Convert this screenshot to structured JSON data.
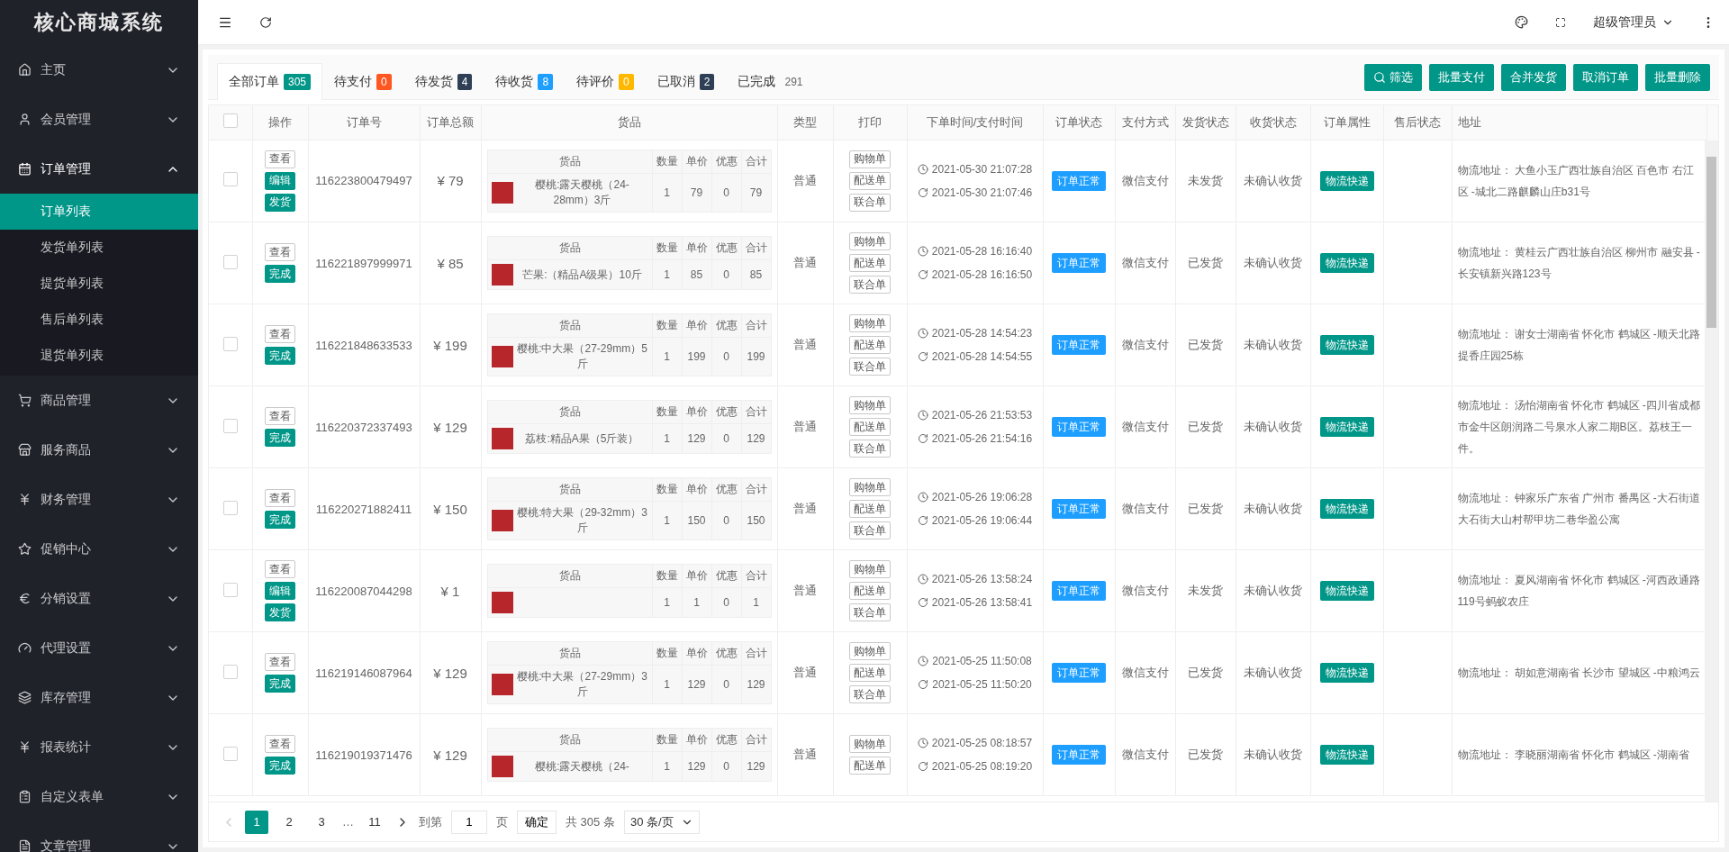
{
  "sidebar": {
    "title": "核心商城系统",
    "items": [
      {
        "label": "主页",
        "expanded": false
      },
      {
        "label": "会员管理",
        "expanded": false
      },
      {
        "label": "订单管理",
        "expanded": true,
        "children": [
          {
            "label": "订单列表",
            "selected": true
          },
          {
            "label": "发货单列表",
            "selected": false
          },
          {
            "label": "提货单列表",
            "selected": false
          },
          {
            "label": "售后单列表",
            "selected": false
          },
          {
            "label": "退货单列表",
            "selected": false
          }
        ]
      },
      {
        "label": "商品管理",
        "expanded": false
      },
      {
        "label": "服务商品",
        "expanded": false
      },
      {
        "label": "财务管理",
        "expanded": false
      },
      {
        "label": "促销中心",
        "expanded": false
      },
      {
        "label": "分销设置",
        "expanded": false
      },
      {
        "label": "代理设置",
        "expanded": false
      },
      {
        "label": "库存管理",
        "expanded": false
      },
      {
        "label": "报表统计",
        "expanded": false
      },
      {
        "label": "自定义表单",
        "expanded": false
      },
      {
        "label": "文章管理",
        "expanded": false
      }
    ]
  },
  "header": {
    "user": "超级管理员"
  },
  "tabs": [
    {
      "label": "全部订单",
      "count": "305",
      "color": "#009688",
      "selected": true
    },
    {
      "label": "待支付",
      "count": "0",
      "color": "#ff5722",
      "selected": false
    },
    {
      "label": "待发货",
      "count": "4",
      "color": "#2f4056",
      "selected": false
    },
    {
      "label": "待收货",
      "count": "8",
      "color": "#1e9fff",
      "selected": false
    },
    {
      "label": "待评价",
      "count": "0",
      "color": "#ffb800",
      "selected": false
    },
    {
      "label": "已取消",
      "count": "2",
      "color": "#2f4056",
      "selected": false
    },
    {
      "label": "已完成",
      "count": "291",
      "selected": false
    }
  ],
  "actions": [
    {
      "label": "筛选",
      "kind": "search"
    },
    {
      "label": "批量支付",
      "kind": "plain"
    },
    {
      "label": "合并发货",
      "kind": "plain"
    },
    {
      "label": "取消订单",
      "kind": "plain"
    },
    {
      "label": "批量删除",
      "kind": "plain"
    }
  ],
  "table": {
    "select_all": {
      "checked": false
    },
    "columns": [
      "操作",
      "订单号",
      "订单总额",
      "货品",
      "类型",
      "打印",
      "下单时间/支付时间",
      "订单状态",
      "支付方式",
      "发货状态",
      "收货状态",
      "订单属性",
      "售后状态",
      "地址"
    ],
    "rows": [
      {
        "checked": false,
        "ops": [
          {
            "label": "查看",
            "kind": "outline"
          },
          {
            "label": "编辑",
            "kind": "primary"
          },
          {
            "label": "发货",
            "kind": "primary"
          }
        ],
        "order_no": "116223800479497",
        "total": "¥ 79",
        "product_header": [
          "货品",
          "数量",
          "单价",
          "优惠",
          "合计"
        ],
        "product": {
          "name": "樱桃:露天樱桃（24-28mm）3斤",
          "qty": "1",
          "price": "79",
          "discount": "0",
          "sum": "79"
        },
        "type": "普通",
        "prints": [
          "购物单",
          "配送单",
          "联合单"
        ],
        "order_time": "2021-05-30 21:07:28",
        "pay_time": "2021-05-30 21:07:46",
        "order_status": "订单正常",
        "pay_method": "微信支付",
        "ship_status": "未发货",
        "receive_status": "未确认收货",
        "attribute": "物流快递",
        "address": "物流地址： 大鱼小玉广西壮族自治区 百色市 右江区 -城北二路麒麟山庄b31号"
      },
      {
        "checked": false,
        "ops": [
          {
            "label": "查看",
            "kind": "outline"
          },
          {
            "label": "完成",
            "kind": "primary"
          }
        ],
        "order_no": "116221897999971",
        "total": "¥ 85",
        "product_header": [
          "货品",
          "数量",
          "单价",
          "优惠",
          "合计"
        ],
        "product": {
          "name": "芒果:（精品A级果）10斤",
          "qty": "1",
          "price": "85",
          "discount": "0",
          "sum": "85"
        },
        "type": "普通",
        "prints": [
          "购物单",
          "配送单",
          "联合单"
        ],
        "order_time": "2021-05-28 16:16:40",
        "pay_time": "2021-05-28 16:16:50",
        "order_status": "订单正常",
        "pay_method": "微信支付",
        "ship_status": "已发货",
        "receive_status": "未确认收货",
        "attribute": "物流快递",
        "address": "物流地址： 黄桂云广西壮族自治区 柳州市 融安县 -长安镇新兴路123号"
      },
      {
        "checked": false,
        "ops": [
          {
            "label": "查看",
            "kind": "outline"
          },
          {
            "label": "完成",
            "kind": "primary"
          }
        ],
        "order_no": "116221848633533",
        "total": "¥ 199",
        "product_header": [
          "货品",
          "数量",
          "单价",
          "优惠",
          "合计"
        ],
        "product": {
          "name": "樱桃:中大果（27-29mm）5斤",
          "qty": "1",
          "price": "199",
          "discount": "0",
          "sum": "199"
        },
        "type": "普通",
        "prints": [
          "购物单",
          "配送单",
          "联合单"
        ],
        "order_time": "2021-05-28 14:54:23",
        "pay_time": "2021-05-28 14:54:55",
        "order_status": "订单正常",
        "pay_method": "微信支付",
        "ship_status": "已发货",
        "receive_status": "未确认收货",
        "attribute": "物流快递",
        "address": "物流地址： 谢女士湖南省 怀化市 鹤城区 -顺天北路提香庄园25栋"
      },
      {
        "checked": false,
        "ops": [
          {
            "label": "查看",
            "kind": "outline"
          },
          {
            "label": "完成",
            "kind": "primary"
          }
        ],
        "order_no": "116220372337493",
        "total": "¥ 129",
        "product_header": [
          "货品",
          "数量",
          "单价",
          "优惠",
          "合计"
        ],
        "product": {
          "name": "荔枝:精品A果（5斤装）",
          "qty": "1",
          "price": "129",
          "discount": "0",
          "sum": "129"
        },
        "type": "普通",
        "prints": [
          "购物单",
          "配送单",
          "联合单"
        ],
        "order_time": "2021-05-26 21:53:53",
        "pay_time": "2021-05-26 21:54:16",
        "order_status": "订单正常",
        "pay_method": "微信支付",
        "ship_status": "已发货",
        "receive_status": "未确认收货",
        "attribute": "物流快递",
        "address": "物流地址： 汤怡湖南省 怀化市 鹤城区 -四川省成都市金牛区朗润路二号泉水人家二期B区。荔枝王一件。"
      },
      {
        "checked": false,
        "ops": [
          {
            "label": "查看",
            "kind": "outline"
          },
          {
            "label": "完成",
            "kind": "primary"
          }
        ],
        "order_no": "116220271882411",
        "total": "¥ 150",
        "product_header": [
          "货品",
          "数量",
          "单价",
          "优惠",
          "合计"
        ],
        "product": {
          "name": "樱桃:特大果（29-32mm）3斤",
          "qty": "1",
          "price": "150",
          "discount": "0",
          "sum": "150"
        },
        "type": "普通",
        "prints": [
          "购物单",
          "配送单",
          "联合单"
        ],
        "order_time": "2021-05-26 19:06:28",
        "pay_time": "2021-05-26 19:06:44",
        "order_status": "订单正常",
        "pay_method": "微信支付",
        "ship_status": "已发货",
        "receive_status": "未确认收货",
        "attribute": "物流快递",
        "address": "物流地址： 钟家乐广东省 广州市 番禺区 -大石街道大石街大山村帮甲坊二巷华盈公寓"
      },
      {
        "checked": false,
        "ops": [
          {
            "label": "查看",
            "kind": "outline"
          },
          {
            "label": "编辑",
            "kind": "primary"
          },
          {
            "label": "发货",
            "kind": "primary"
          }
        ],
        "order_no": "116220087044298",
        "total": "¥ 1",
        "product_header": [
          "货品",
          "数量",
          "单价",
          "优惠",
          "合计"
        ],
        "product": {
          "qty": "1",
          "price": "1",
          "discount": "0",
          "sum": "1"
        },
        "type": "普通",
        "prints": [
          "购物单",
          "配送单",
          "联合单"
        ],
        "order_time": "2021-05-26 13:58:24",
        "pay_time": "2021-05-26 13:58:41",
        "order_status": "订单正常",
        "pay_method": "微信支付",
        "ship_status": "未发货",
        "receive_status": "未确认收货",
        "attribute": "物流快递",
        "address": "物流地址： 夏风湖南省 怀化市 鹤城区 -河西政通路119号蚂蚁农庄"
      },
      {
        "checked": false,
        "ops": [
          {
            "label": "查看",
            "kind": "outline"
          },
          {
            "label": "完成",
            "kind": "primary"
          }
        ],
        "order_no": "116219146087964",
        "total": "¥ 129",
        "product_header": [
          "货品",
          "数量",
          "单价",
          "优惠",
          "合计"
        ],
        "product": {
          "name": "樱桃:中大果（27-29mm）3斤",
          "qty": "1",
          "price": "129",
          "discount": "0",
          "sum": "129"
        },
        "type": "普通",
        "prints": [
          "购物单",
          "配送单",
          "联合单"
        ],
        "order_time": "2021-05-25 11:50:08",
        "pay_time": "2021-05-25 11:50:20",
        "order_status": "订单正常",
        "pay_method": "微信支付",
        "ship_status": "已发货",
        "receive_status": "未确认收货",
        "attribute": "物流快递",
        "address": "物流地址： 胡如意湖南省 长沙市 望城区 -中粮鸿云"
      },
      {
        "checked": false,
        "ops": [
          {
            "label": "查看",
            "kind": "outline"
          },
          {
            "label": "完成",
            "kind": "primary"
          }
        ],
        "order_no": "116219019371476",
        "total": "¥ 129",
        "product_header": [
          "货品",
          "数量",
          "单价",
          "优惠",
          "合计"
        ],
        "product": {
          "name": "樱桃:露天樱桃（24-",
          "qty": "1",
          "price": "129",
          "discount": "0",
          "sum": "129"
        },
        "type": "普通",
        "prints": [
          "购物单",
          "配送单"
        ],
        "order_time": "2021-05-25 08:18:57",
        "pay_time": "2021-05-25 08:19:20",
        "order_status": "订单正常",
        "pay_method": "微信支付",
        "ship_status": "已发货",
        "receive_status": "未确认收货",
        "attribute": "物流快递",
        "address": "物流地址： 李晓丽湖南省 怀化市 鹤城区 -湖南省"
      }
    ]
  },
  "pagination": {
    "pages": [
      {
        "label": "1",
        "selected": true
      },
      {
        "label": "2",
        "selected": false
      },
      {
        "label": "3",
        "selected": false
      }
    ],
    "ellipsis": "…",
    "last": "11",
    "goto_label": "到第",
    "goto_value": "1",
    "page_unit": "页",
    "confirm": "确定",
    "total": "共 305 条",
    "page_size": "30 条/页"
  }
}
